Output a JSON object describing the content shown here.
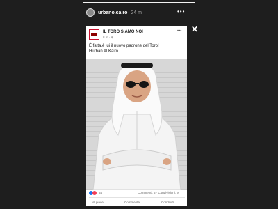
{
  "story": {
    "username": "urbano.cairo",
    "time": "24 m",
    "more_icon": "more-horizontal-icon",
    "close_icon": "close-icon",
    "progress_fraction": 1.0
  },
  "post": {
    "page_name": "IL TORO SIAMO NOI",
    "meta": "8 m · ⊕",
    "caption_line1": "È fatta,è lui il nuovo padrone del Toro!",
    "caption_line2": "Hurban Al Kairo",
    "reactions_count": "64",
    "comments_shares": "Commenti: 5 · Condivisioni: 9",
    "actions": {
      "like": "Mi piace",
      "comment": "Commenta",
      "share": "Condividi"
    }
  },
  "colors": {
    "background": "#1e1e1e",
    "card": "#ffffff",
    "like_blue": "#1877f2",
    "love_red": "#f33e58"
  }
}
